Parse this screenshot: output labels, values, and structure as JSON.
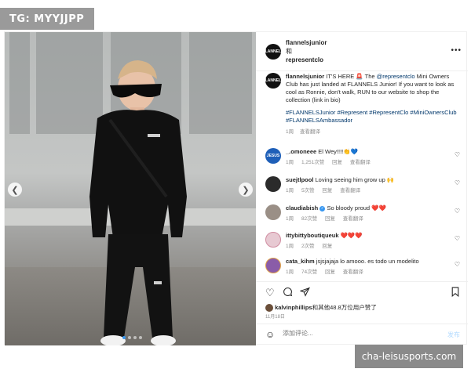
{
  "watermark_top": "TG: MYYJJPP",
  "watermark_bottom": "cha-leisusports.com",
  "header": {
    "user1": "flannelsjunior",
    "joiner": "和",
    "user2": "representclo",
    "avatar_text": "FLANNELS"
  },
  "caption": {
    "user": "flannelsjunior",
    "text_a": " IT'S HERE 🚨 The ",
    "mention": "@representclo",
    "text_b": " Mini Owners Club has just landed at FLANNELS Junior! If you want to look as cool as Ronnie, don't walk, RUN to our website to shop the collection (link in bio)",
    "tags": "#FLANNELSJunior #Represent #RepresentClo #MiniOwnersClub #FLANNELSAmbassador",
    "time": "1周",
    "translate": "查看翻译"
  },
  "comments": [
    {
      "user": "_.omoneee",
      "text": "El Wey!!!!👏💙",
      "time": "1周",
      "likes": "1,251次赞",
      "reply": "回复",
      "translate": "查看翻译",
      "avatar_text": "JESUS",
      "avatar_color": "#1e5fb8"
    },
    {
      "user": "suejtlpool",
      "text": "Loving seeing him grow up 🙌",
      "time": "1周",
      "likes": "5次赞",
      "reply": "回复",
      "translate": "查看翻译",
      "avatar_text": "",
      "avatar_color": "#2b2b2b"
    },
    {
      "user": "claudiabish",
      "text": "So bloody proud ❤️❤️",
      "time": "1周",
      "likes": "82次赞",
      "reply": "回复",
      "translate": "查看翻译",
      "avatar_text": "",
      "avatar_color": "#9a8f86",
      "verified": true
    },
    {
      "user": "ittybittyboutiqueuk",
      "text": "❤️❤️❤️",
      "time": "1周",
      "likes": "2次赞",
      "reply": "回复",
      "translate": "",
      "avatar_text": "",
      "avatar_color": "#e7c9d2"
    },
    {
      "user": "cata_kihm",
      "text": "jsjsjajaja lo amooo. es todo un modelito",
      "time": "1周",
      "likes": "74次赞",
      "reply": "回复",
      "translate": "查看翻译",
      "avatar_text": "",
      "avatar_color": "#8a5ca8"
    }
  ],
  "likes_line": {
    "user": "kalvinphillips",
    "text": "和其他48.8万位用户赞了"
  },
  "date": "11月18日",
  "comment_box": {
    "placeholder": "添加评论...",
    "post_label": "发布"
  },
  "icons": {
    "like": "heart-icon",
    "comment": "comment-icon",
    "share": "share-icon",
    "save": "bookmark-icon",
    "more": "more-icon",
    "emoji": "emoji-icon"
  },
  "colors": {
    "link": "#00376b",
    "meta": "#8e8e8e",
    "accent": "#3897f0"
  }
}
